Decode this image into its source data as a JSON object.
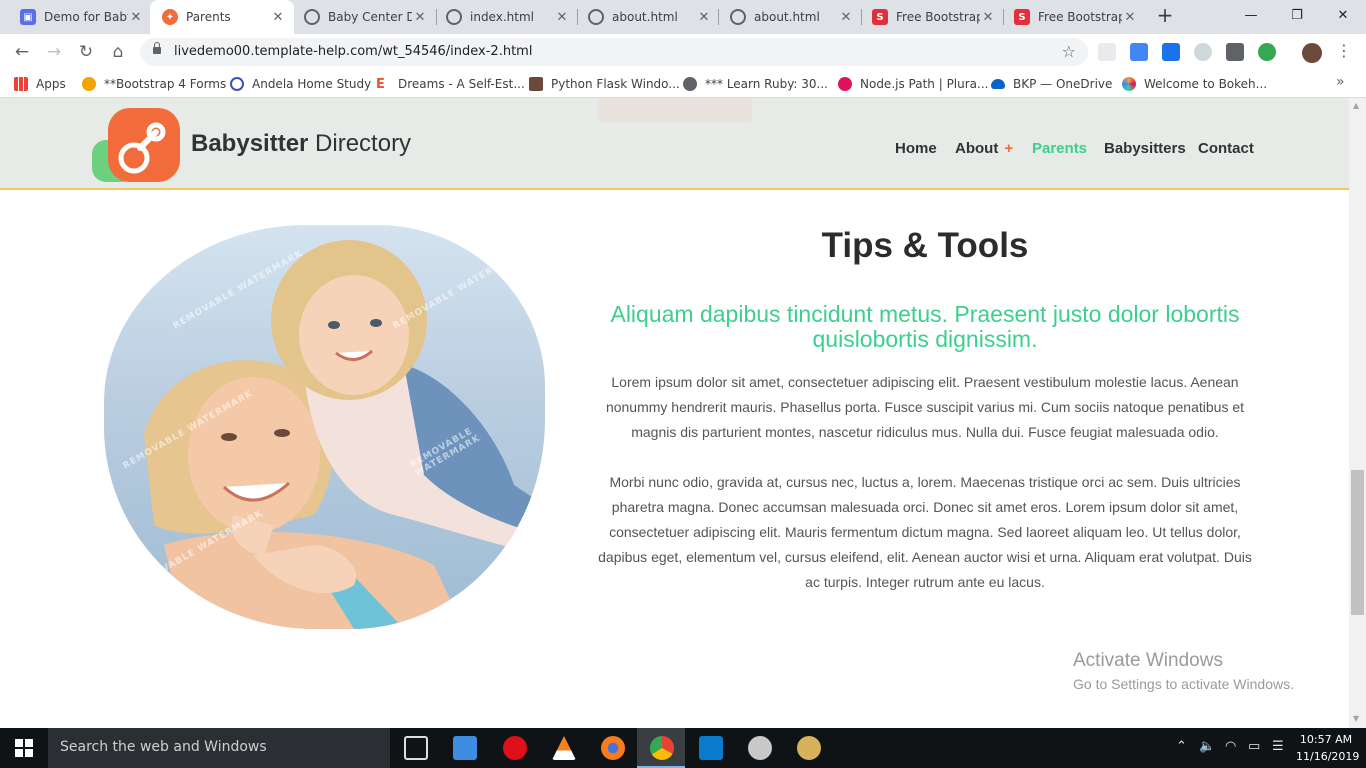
{
  "browser": {
    "tabs": [
      {
        "title": "Demo for Baby",
        "active": false,
        "favicon_color": "#5b6ee8"
      },
      {
        "title": "Parents",
        "active": true,
        "favicon_color": "#f26b3a"
      },
      {
        "title": "Baby Center D",
        "active": false,
        "favicon_color": "#5f6368"
      },
      {
        "title": "index.html",
        "active": false,
        "favicon_color": "#5f6368"
      },
      {
        "title": "about.html",
        "active": false,
        "favicon_color": "#5f6368"
      },
      {
        "title": "about.html",
        "active": false,
        "favicon_color": "#5f6368"
      },
      {
        "title": "Free Bootstrap",
        "active": false,
        "favicon_color": "#e0303b"
      },
      {
        "title": "Free Bootstrap",
        "active": false,
        "favicon_color": "#e0303b"
      }
    ],
    "new_tab_label": "+",
    "url": "livedemo00.template-help.com/wt_54546/index-2.html",
    "bookmarks": [
      {
        "label": "Apps",
        "icon": "apps-grid-icon",
        "color": "#ea4335"
      },
      {
        "label": "**Bootstrap 4 Forms",
        "icon": "bootstrap-forms-icon",
        "color": "#f4a300"
      },
      {
        "label": "Andela Home Study",
        "icon": "andela-icon",
        "color": "#3f51b5"
      },
      {
        "label": "Dreams - A Self-Est...",
        "icon": "dreams-icon",
        "color": "#e8562a"
      },
      {
        "label": "Python Flask Windo...",
        "icon": "python-flask-icon",
        "color": "#6b4a3a"
      },
      {
        "label": "*** Learn Ruby: 30...",
        "icon": "globe-icon",
        "color": "#5f6368"
      },
      {
        "label": "Node.js Path | Plura...",
        "icon": "pluralsight-icon",
        "color": "#e0115f"
      },
      {
        "label": "BKP — OneDrive",
        "icon": "onedrive-icon",
        "color": "#0a64c8"
      },
      {
        "label": "Welcome to Bokeh...",
        "icon": "bokeh-icon",
        "color": "#e9a23b"
      }
    ]
  },
  "site": {
    "brand_bold": "Babysitter",
    "brand_rest": " Directory",
    "nav": [
      {
        "label": "Home",
        "active": false
      },
      {
        "label": "About",
        "active": false,
        "has_submenu": true,
        "submenu_marker": "+"
      },
      {
        "label": "Parents",
        "active": true
      },
      {
        "label": "Babysitters",
        "active": false
      },
      {
        "label": "Contact",
        "active": false
      }
    ],
    "section": {
      "title": "Tips & Tools",
      "subtitle": "Aliquam dapibus tincidunt metus. Praesent justo dolor lobortis quislobortis dignissim.",
      "paragraph1": "Lorem ipsum dolor sit amet, consectetuer adipiscing elit. Praesent vestibulum molestie lacus. Aenean nonummy hendrerit mauris. Phasellus porta. Fusce suscipit varius mi. Cum sociis natoque penatibus et magnis dis parturient montes, nascetur ridiculus mus. Nulla dui. Fusce feugiat malesuada odio.",
      "paragraph2": "Morbi nunc odio, gravida at, cursus nec, luctus a, lorem. Maecenas tristique orci ac sem. Duis ultricies pharetra magna. Donec accumsan malesuada orci. Donec sit amet eros. Lorem ipsum dolor sit amet, consectetuer adipiscing elit. Mauris fermentum dictum magna. Sed laoreet aliquam leo. Ut tellus dolor, dapibus eget, elementum vel, cursus eleifend, elit. Aenean auctor wisi et urna. Aliquam erat volutpat. Duis ac turpis. Integer rutrum ante eu lacus.",
      "watermark": "REMOVABLE WATERMARK"
    },
    "colors": {
      "accent": "#3ccf8e",
      "brand_orange": "#f26b3a",
      "header_bg": "#e6ebe8"
    }
  },
  "overlay": {
    "activate_title": "Activate Windows",
    "activate_sub": "Go to Settings to activate Windows."
  },
  "taskbar": {
    "search_placeholder": "Search the web and Windows",
    "time": "10:57 AM",
    "date": "11/16/2019"
  }
}
